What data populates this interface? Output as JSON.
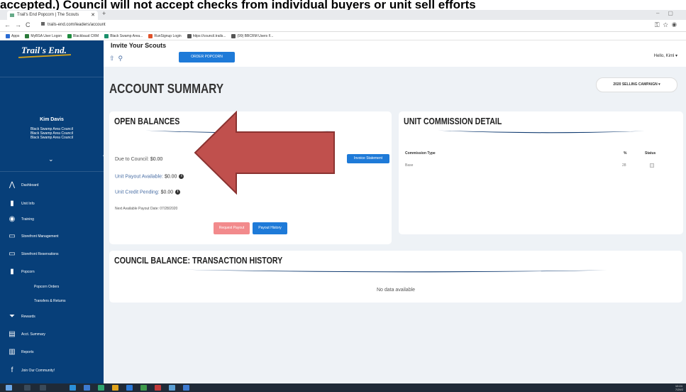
{
  "caption": "accepted.) Council will not accept checks from individual buyers or unit sell efforts",
  "browser": {
    "tab_title": "Trail's End Popcorn | The Scouts",
    "new_tab": "+",
    "url": "trails-end.com/leaders/account",
    "bookmarks": [
      "Apps",
      "MyBSA User Logon",
      "Blackbaud CRM",
      "Black Swamp Area...",
      "RunSignup Login",
      "https://council.trails...",
      "(99) BBCRM Users F..."
    ],
    "bookmark_colors": [
      "#2b6cd3",
      "#2b7a3a",
      "#1f8c3f",
      "#1a8f6b",
      "#e0522a",
      "#555555",
      "#555555"
    ]
  },
  "sidebar": {
    "logo": "Trail's End.",
    "user_name": "Kim Davis",
    "councils": [
      "Black Swamp Area Council",
      "Black Swamp Area Council",
      "Black Swamp Area Council"
    ],
    "expand_icon": "chevron-down-icon",
    "collapse_icon": "chevron-left-icon",
    "items": [
      {
        "label": "Dashboard",
        "icon": "dashboard-icon",
        "glyph": "⋀"
      },
      {
        "label": "Unit Info",
        "icon": "unit-info-icon",
        "glyph": "▮"
      },
      {
        "label": "Training",
        "icon": "training-icon",
        "glyph": "◉"
      },
      {
        "label": "Storefront Management",
        "icon": "storefront-icon",
        "glyph": "▭"
      },
      {
        "label": "Storefront Reservations",
        "icon": "storefront-reservations-icon",
        "glyph": "▭"
      },
      {
        "label": "Popcorn",
        "icon": "popcorn-icon",
        "glyph": "▮"
      },
      {
        "label": "Popcorn Orders",
        "icon": "",
        "glyph": ""
      },
      {
        "label": "Transfers & Returns",
        "icon": "",
        "glyph": ""
      },
      {
        "label": "Rewards",
        "icon": "trophy-icon",
        "glyph": "⏷"
      },
      {
        "label": "Acct. Summary",
        "icon": "account-summary-icon",
        "glyph": "▤"
      },
      {
        "label": "Reports",
        "icon": "reports-icon",
        "glyph": "▥"
      },
      {
        "label": "Join Our Community!",
        "icon": "facebook-icon",
        "glyph": "f"
      }
    ]
  },
  "topbar": {
    "invite_label": "Invite Your Scouts",
    "order_button": "ORDER POPCORN",
    "greeting": "Hello, Kiml"
  },
  "page": {
    "title": "ACCOUNT SUMMARY",
    "campaign": "2020 SELLING CAMPAIGN"
  },
  "open_balances": {
    "title": "OPEN BALANCES",
    "due_label": "Due to Council:",
    "due_value": "$0.00",
    "payout_label": "Unit Payout Available:",
    "payout_value": "$0.00",
    "credit_label": "Unit Credit Pending:",
    "credit_value": "$0.00",
    "payout_date": "Next Available Payout Date: 07/28/2020",
    "invoice_button": "Invoice Statement",
    "request_button": "Request Payout",
    "history_button": "Payout History"
  },
  "unit_commission": {
    "title": "UNIT COMMISSION DETAIL",
    "headers": [
      "Commission Type",
      "%",
      "Status"
    ],
    "rows": [
      {
        "type": "Base",
        "percent": "28"
      }
    ]
  },
  "transactions": {
    "title": "COUNCIL BALANCE: TRANSACTION HISTORY",
    "empty": "No data available"
  },
  "taskbar": {
    "clock": [
      "10:24",
      "7/29/2"
    ]
  },
  "colors": {
    "sidebar": "#073f79",
    "accent": "#1e7ad8",
    "arrow": "#c0504d",
    "swoosh": "#0f3a70"
  }
}
